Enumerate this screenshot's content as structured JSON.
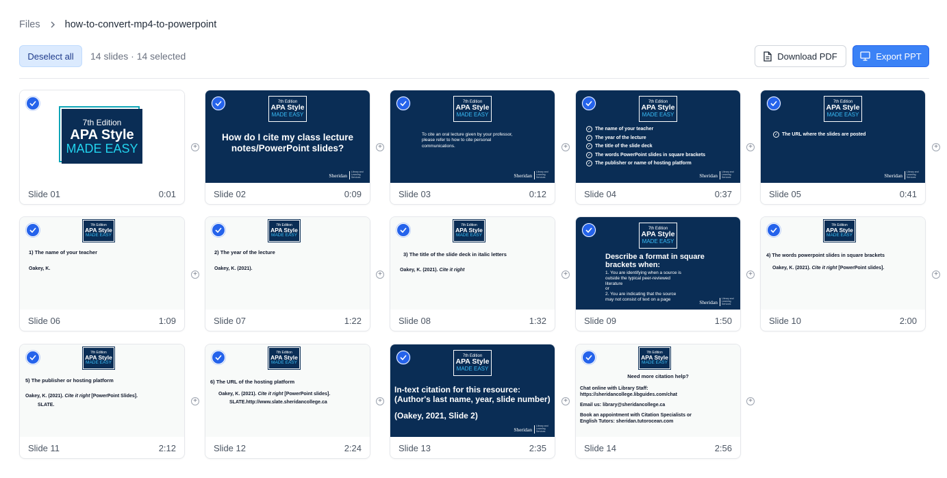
{
  "breadcrumb": {
    "root": "Files",
    "current": "how-to-convert-mp4-to-powerpoint"
  },
  "toolbar": {
    "deselect_label": "Deselect all",
    "selection_summary": "14 slides · 14 selected",
    "download_pdf_label": "Download PDF",
    "export_ppt_label": "Export PPT"
  },
  "colors": {
    "accent": "#3b82f6",
    "slide_dark": "#0a2d55",
    "logo_cyan": "#38bdf8"
  },
  "icons": {
    "breadcrumb_separator": "chevron-right-icon",
    "pdf": "document-icon",
    "ppt": "presentation-icon",
    "selected": "check-icon",
    "insert": "plus-icon"
  },
  "logo": {
    "edition": "7th Edition",
    "title": "APA Style",
    "subtitle": "MADE EASY"
  },
  "brand": {
    "name": "Sheridan",
    "sub": "Library and Learning Services"
  },
  "slides": [
    {
      "label": "Slide 01",
      "time": "0:01",
      "selected": true
    },
    {
      "label": "Slide 02",
      "time": "0:09",
      "selected": true,
      "heading": "How do I cite my class lecture notes/PowerPoint slides?"
    },
    {
      "label": "Slide 03",
      "time": "0:12",
      "selected": true,
      "text": "To cite an oral lecture given by your professor, please refer to how to cite personal communications."
    },
    {
      "label": "Slide 04",
      "time": "0:37",
      "selected": true,
      "items": [
        "The name of your teacher",
        "The year of the lecture",
        "The title of the slide deck",
        "The words PowerPoint slides in square brackets",
        "The publisher or name of hosting platform"
      ]
    },
    {
      "label": "Slide 05",
      "time": "0:41",
      "selected": true,
      "items": [
        "The URL where the slides are posted"
      ]
    },
    {
      "label": "Slide 06",
      "time": "1:09",
      "selected": true,
      "heading": "1) The name of your teacher",
      "citation": "Oakey, K."
    },
    {
      "label": "Slide 07",
      "time": "1:22",
      "selected": true,
      "heading": "2) The year of the lecture",
      "citation": "Oakey, K. (2021)."
    },
    {
      "label": "Slide 08",
      "time": "1:32",
      "selected": true,
      "heading": "3) The title of the slide deck in italic letters",
      "citation": "Oakey, K. (2021). ",
      "citation_italic": "Cite it right"
    },
    {
      "label": "Slide 09",
      "time": "1:50",
      "selected": true,
      "heading": "Describe a format in square brackets when:",
      "lines": [
        "1. You are identifying when a source is",
        "outside the typical peer-reviewed",
        "literature",
        "or",
        "2. You are indicating that the source",
        "may not consist of text on a page"
      ]
    },
    {
      "label": "Slide 10",
      "time": "2:00",
      "selected": true,
      "heading": "4) The words powerpoint slides in square brackets",
      "citation": "Oakey, K. (2021). ",
      "citation_italic": "Cite it right",
      "citation_after": " [PowerPoint slides]."
    },
    {
      "label": "Slide 11",
      "time": "2:12",
      "selected": true,
      "heading": "5) The publisher or hosting platform",
      "citation": "Oakey, K. (2021). ",
      "citation_italic": "Cite it right",
      "citation_after": " [PowerPoint Slides].",
      "citation_line2": "SLATE."
    },
    {
      "label": "Slide 12",
      "time": "2:24",
      "selected": true,
      "heading": "6) The URL of the hosting platform",
      "citation": "Oakey, K. (2021). ",
      "citation_italic": "Cite it right",
      "citation_after": " [PowerPoint slides].",
      "citation_line2": "SLATE.http://www.slate.sheridancollege.ca"
    },
    {
      "label": "Slide 13",
      "time": "2:35",
      "selected": true,
      "heading": "In-text citation for this resource: (Author's last name, year, slide number)",
      "example": "(Oakey, 2021, Slide 2)"
    },
    {
      "label": "Slide 14",
      "time": "2:56",
      "selected": true,
      "heading": "Need more citation help?",
      "lines": [
        "Chat online with Library Staff:",
        "https://sheridancollege.libguides.com/chat",
        "Email us: library@sheridancollege.ca",
        "Book an appointment with Citation Specialists or",
        "English Tutors: sheridan.tutorocean.com"
      ]
    }
  ]
}
